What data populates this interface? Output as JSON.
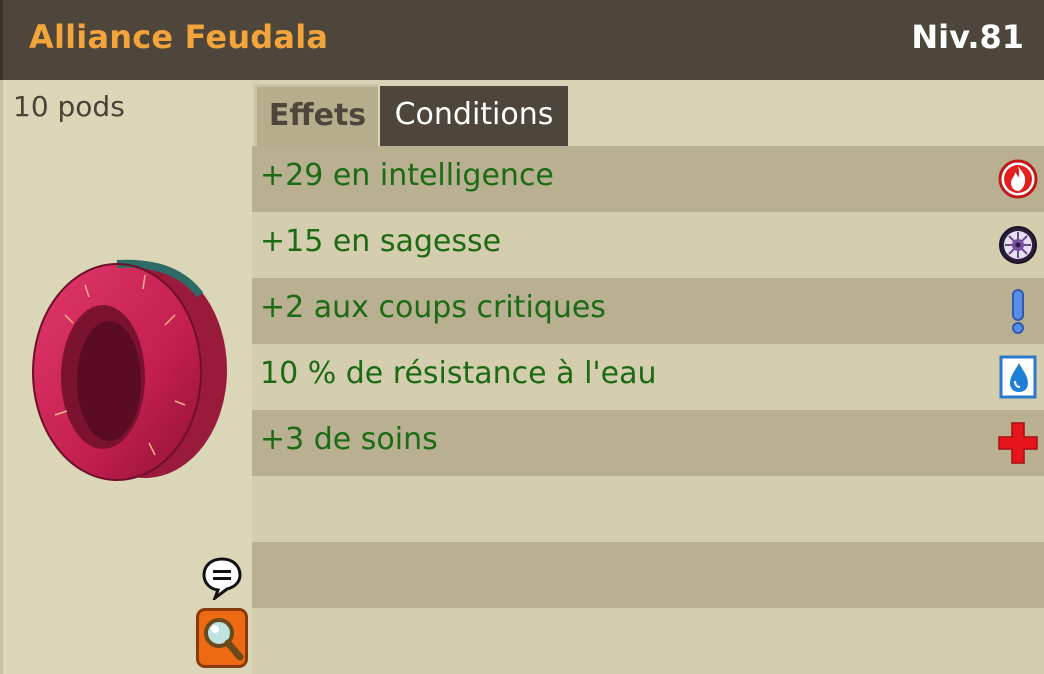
{
  "item": {
    "name": "Alliance Feudala",
    "level": "Niv.81",
    "weight": "10 pods"
  },
  "tabs": [
    {
      "label": "Effets",
      "active": true
    },
    {
      "label": "Conditions",
      "active": false
    }
  ],
  "effects": [
    {
      "text": "+29 en intelligence",
      "icon": "fire-intelligence-icon"
    },
    {
      "text": "+15 en sagesse",
      "icon": "wisdom-eye-icon"
    },
    {
      "text": "+2 aux coups critiques",
      "icon": "critical-exclamation-icon"
    },
    {
      "text": "10 % de résistance à l'eau",
      "icon": "water-drop-icon"
    },
    {
      "text": "+3 de soins",
      "icon": "heal-cross-icon"
    }
  ],
  "colors": {
    "title_bar": "#4e463b",
    "item_name": "#f3a43a",
    "effect_text": "#1c6b14",
    "ring": "#c8234f"
  }
}
